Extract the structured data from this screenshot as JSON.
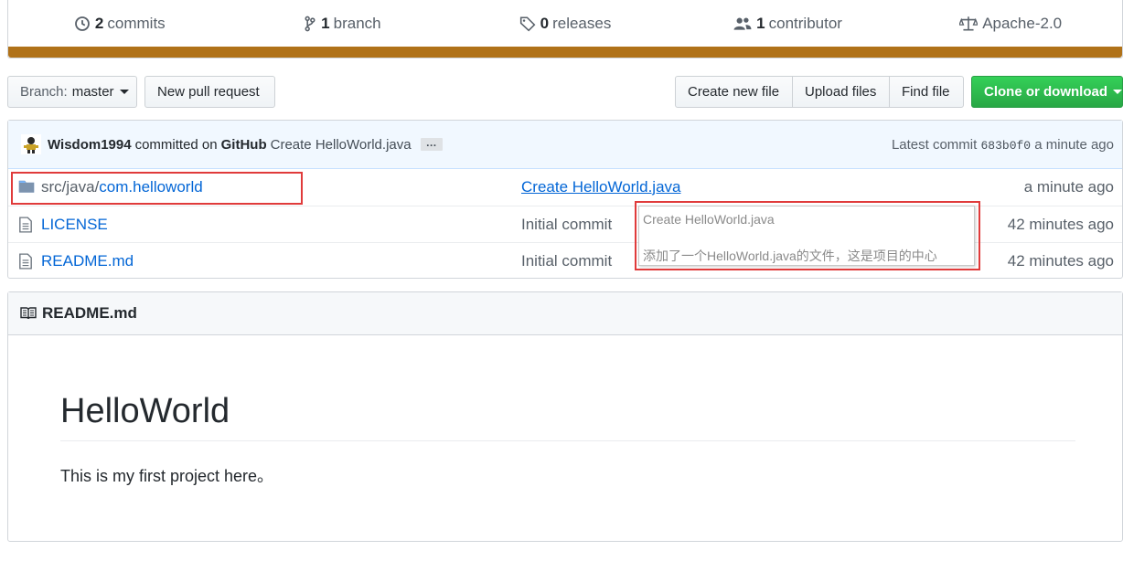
{
  "summary": {
    "commits": {
      "count": "2",
      "label": "commits"
    },
    "branches": {
      "count": "1",
      "label": "branch"
    },
    "releases": {
      "count": "0",
      "label": "releases"
    },
    "contributors": {
      "count": "1",
      "label": "contributor"
    },
    "license": {
      "label": "Apache-2.0"
    },
    "language_color": "#b07219"
  },
  "toolbar": {
    "branch_prefix": "Branch:",
    "branch_name": "master",
    "new_pull_request": "New pull request",
    "create_new_file": "Create new file",
    "upload_files": "Upload files",
    "find_file": "Find file",
    "clone_or_download": "Clone or download"
  },
  "commit_tease": {
    "author": "Wisdom1994",
    "committed_on": "committed on",
    "platform": "GitHub",
    "title": "Create HelloWorld.java",
    "ellipsis": "…",
    "latest_label": "Latest commit",
    "sha": "683b0f0",
    "age": "a minute ago"
  },
  "files": [
    {
      "path_prefix": "src/java/",
      "name": "com.helloworld",
      "type": "folder-icon",
      "message": "Create HelloWorld.java",
      "age": "a minute ago"
    },
    {
      "path_prefix": "",
      "name": "LICENSE",
      "type": "file-icon",
      "message": "Initial commit",
      "age": "42 minutes ago"
    },
    {
      "path_prefix": "",
      "name": "README.md",
      "type": "file-icon",
      "message": "Initial commit",
      "age": "42 minutes ago"
    }
  ],
  "tooltip": {
    "line1": "Create HelloWorld.java",
    "line2": "添加了一个HelloWorld.java的文件，这是项目的中心"
  },
  "readme": {
    "header": "README.md",
    "heading": "HelloWorld",
    "paragraph": "This is my first project here。"
  },
  "colors": {
    "link": "#0366d6",
    "highlight": "#e03b3b",
    "green_button": "#28a745"
  }
}
